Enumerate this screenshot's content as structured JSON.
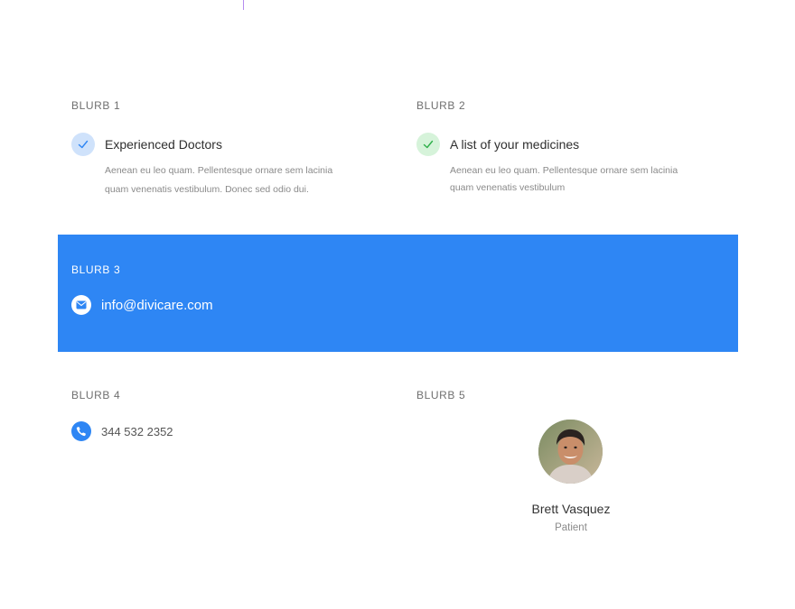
{
  "blurb1": {
    "label": "BLURB 1",
    "title": "Experienced Doctors",
    "text_line1": "Aenean eu leo quam. Pellentesque ornare sem lacinia",
    "text_line2": "quam venenatis vestibulum. Donec sed odio dui.",
    "icon": "check-icon",
    "icon_bg": "#cfe2fb",
    "icon_color": "#2e86f4"
  },
  "blurb2": {
    "label": "BLURB 2",
    "title": "A list of your medicines",
    "text_line1": "Aenean eu leo quam. Pellentesque ornare sem lacinia",
    "text_line2": "quam venenatis vestibulum",
    "icon": "check-icon",
    "icon_bg": "#d6f3da",
    "icon_color": "#2fb04a"
  },
  "blurb3": {
    "label": "BLURB 3",
    "email": "info@divicare.com",
    "icon": "mail-icon",
    "background": "#2e86f4"
  },
  "blurb4": {
    "label": "BLURB 4",
    "phone": "344 532 2352",
    "icon": "phone-icon"
  },
  "blurb5": {
    "label": "BLURB 5",
    "name": "Brett Vasquez",
    "role": "Patient",
    "image": "avatar-photo"
  }
}
